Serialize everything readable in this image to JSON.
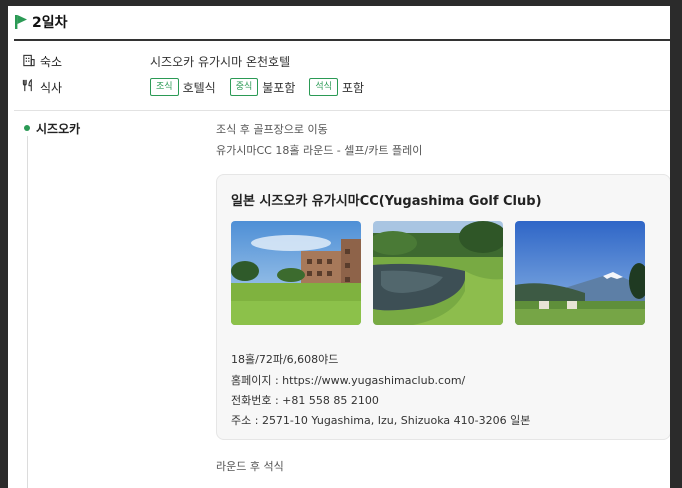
{
  "day": {
    "title": "2일차"
  },
  "lodging": {
    "label": "숙소",
    "value": "시즈오카 유가시마 온천호텔"
  },
  "meals": {
    "label": "식사",
    "items": [
      {
        "tag": "조식",
        "value": "호텔식"
      },
      {
        "tag": "중식",
        "value": "불포함"
      },
      {
        "tag": "석식",
        "value": "포함"
      }
    ]
  },
  "schedule": {
    "place": "시즈오카",
    "lines": [
      "조식 후 골프장으로 이동",
      "유가시마CC 18홀 라운드 - 셀프/카트 플레이"
    ],
    "after": "라운드 후 석식"
  },
  "card": {
    "title": "일본 시즈오카 유가시마CC(Yugashima Golf Club)",
    "details": [
      "18홀/72파/6,608야드",
      "홈페이지 : https://www.yugashimaclub.com/",
      "전화번호 : +81 558 85 2100",
      "주소 : 2571-10 Yugashima, Izu, Shizuoka 410-3206 일본"
    ]
  },
  "colors": {
    "accent": "#2b9a55"
  }
}
